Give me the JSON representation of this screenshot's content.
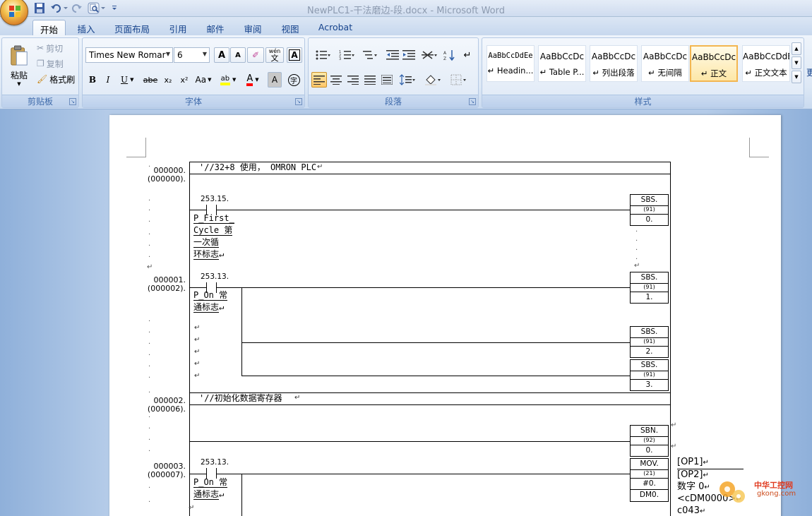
{
  "window": {
    "title": "NewPLC1-干法磨边-段.docx - Microsoft Word"
  },
  "tabs": [
    {
      "label": "开始",
      "active": true
    },
    {
      "label": "插入"
    },
    {
      "label": "页面布局"
    },
    {
      "label": "引用"
    },
    {
      "label": "邮件"
    },
    {
      "label": "审阅"
    },
    {
      "label": "视图"
    },
    {
      "label": "Acrobat"
    }
  ],
  "clipboard": {
    "label": "剪贴板",
    "paste": "粘贴",
    "cut": "剪切",
    "copy": "复制",
    "format_painter": "格式刷"
  },
  "font": {
    "label": "字体",
    "family": "Times New Romar",
    "size": "6",
    "bold": "B",
    "italic": "I",
    "underline": "U",
    "strike": "abe",
    "subscript": "x₂",
    "superscript": "x²",
    "change_case": "Aa",
    "highlight": "ab",
    "font_color": "A",
    "char_shading": "A",
    "grow": "A",
    "shrink": "A",
    "phonetic": "wén",
    "phonetic_char": "文",
    "enclose": "字",
    "highlight_color": "#ffff00",
    "font_color_value": "#ff0000"
  },
  "paragraph": {
    "label": "段落"
  },
  "styles": {
    "label": "样式",
    "items": [
      {
        "sample": "AaBbCcDdEe",
        "name": "Headin...",
        "mono": true
      },
      {
        "sample": "AaBbCcDc",
        "name": "Table P..."
      },
      {
        "sample": "AaBbCcDc",
        "name": "列出段落"
      },
      {
        "sample": "AaBbCcDc",
        "name": "无间隔"
      },
      {
        "sample": "AaBbCcDc",
        "name": "正文",
        "selected": true
      },
      {
        "sample": "AaBbCcDdE",
        "name": "正文文本"
      }
    ],
    "more": "更"
  },
  "ladder": {
    "rung0": {
      "step": "000000.",
      "addr": "(000000).",
      "comment": "'//32+8 使用， OMRON PLC"
    },
    "rung1": {
      "contact_addr": "253.15.",
      "contact_label": [
        "P_First_",
        "Cycle 第",
        "一次循",
        "环标志"
      ],
      "sbs_name": "SBS.",
      "sbs_code": "(91)",
      "sbs_value": "0."
    },
    "rung2": {
      "step": "000001.",
      "addr": "(000002).",
      "contact_addr": "253.13.",
      "contact_label": [
        "P_On 常",
        "通标志"
      ],
      "sbs": [
        {
          "name": "SBS.",
          "code": "(91)",
          "value": "1."
        },
        {
          "name": "SBS.",
          "code": "(91)",
          "value": "2."
        },
        {
          "name": "SBS.",
          "code": "(91)",
          "value": "3."
        }
      ]
    },
    "rung3": {
      "step": "000002.",
      "addr": "(000006).",
      "comment": "'//初始化数据寄存器"
    },
    "rung4": {
      "sbn_name": "SBN.",
      "sbn_code": "(92)",
      "sbn_value": "0."
    },
    "rung5": {
      "step": "000003.",
      "addr": "(000007).",
      "contact_addr": "253.13.",
      "contact_label": [
        "P_On 常",
        "通标志"
      ],
      "mov_name": "MOV.",
      "mov_code": "(21)",
      "mov_src": "#0.",
      "mov_dst": "DM0."
    }
  },
  "side_notes": [
    "[OP1]",
    "[OP2]",
    "数字 0",
    "<cDM0000>",
    "c043"
  ],
  "watermark": {
    "brand": "中华工控网",
    "domain": "gkong.com"
  }
}
